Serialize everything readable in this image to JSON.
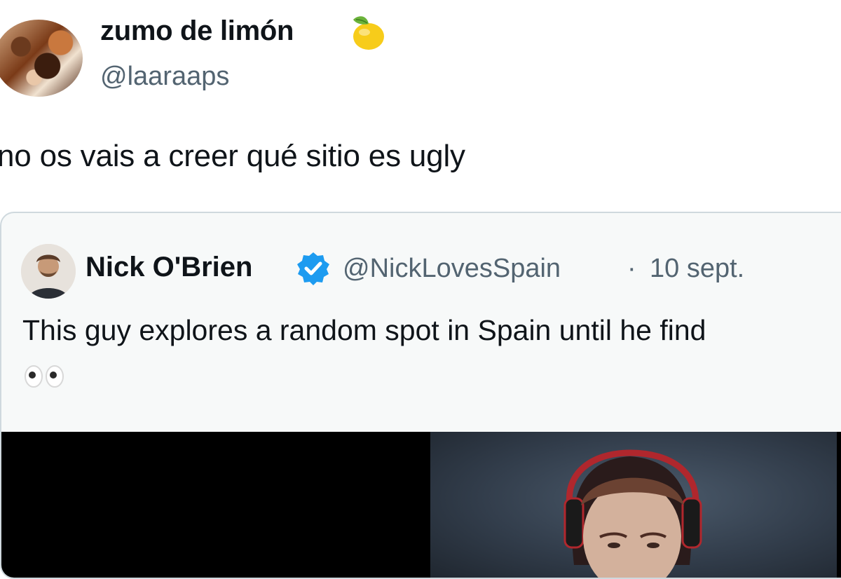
{
  "author": {
    "display_name": "zumo de limón",
    "emoji": "lemon-icon",
    "handle": "@laaraaps"
  },
  "tweet": {
    "text": "no os vais a creer qué sitio es ugly"
  },
  "quoted": {
    "display_name": "Nick O'Brien",
    "verified": true,
    "handle": "@NickLovesSpain",
    "separator": "·",
    "date": "10 sept.",
    "text": "This guy explores a random spot in Spain until he find",
    "emoji": "eyes-icon"
  },
  "colors": {
    "text": "#0f1419",
    "secondary": "#536471",
    "verified": "#1d9bf0",
    "border": "#cfd9de"
  }
}
